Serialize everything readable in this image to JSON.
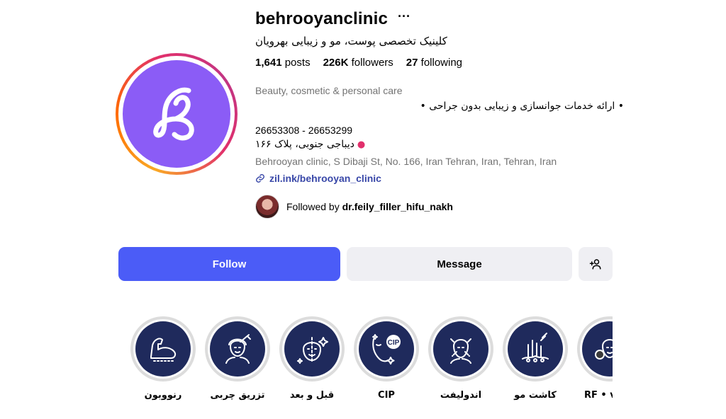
{
  "profile": {
    "username": "behrooyanclinic",
    "more_icon": "more-horizontal-icon",
    "full_name": "کلینیک تخصصی پوست، مو و زیبایی بهرویان",
    "stats": {
      "posts_count": "1,641",
      "posts_label": "posts",
      "followers_count": "226K",
      "followers_label": "followers",
      "following_count": "27",
      "following_label": "following"
    },
    "category": "Beauty, cosmetic & personal care",
    "bio_line": "• ارائه خدمات جوانسازی و زیبایی بدون جراحی •",
    "phone": "26653308 - 26653299",
    "address_fa": "دیباجی جنوبی، پلاک ۱۶۶",
    "address_en": "Behrooyan clinic, S Dibaji St, No. 166, Iran Tehran, Iran, Tehran, Iran",
    "link": "zil.ink/behrooyan_clinic",
    "followed_by_prefix": "Followed by",
    "followed_by_user": "dr.feily_filler_hifu_nakh"
  },
  "actions": {
    "follow": "Follow",
    "message": "Message",
    "add_user_icon": "add-user-icon"
  },
  "highlights": [
    {
      "label": "رنووبون",
      "icon": "flexed-arm-icon"
    },
    {
      "label": "تزریق چربی",
      "icon": "face-injection-icon"
    },
    {
      "label": "قبل و بعد",
      "icon": "before-after-face-icon"
    },
    {
      "label": "CIP",
      "icon": "cip-face-icon",
      "badge": "CIP"
    },
    {
      "label": "اندولیفت",
      "icon": "face-lift-icon"
    },
    {
      "label": "کاشت مو",
      "icon": "hair-transplant-icon"
    },
    {
      "label": "RF • vi",
      "icon": "rf-face-icon"
    }
  ],
  "colors": {
    "follow_button": "#4b5cf7",
    "avatar_bg": "#8b5cf6",
    "highlight_bg": "#1f2a5c",
    "link": "#3847a8"
  }
}
